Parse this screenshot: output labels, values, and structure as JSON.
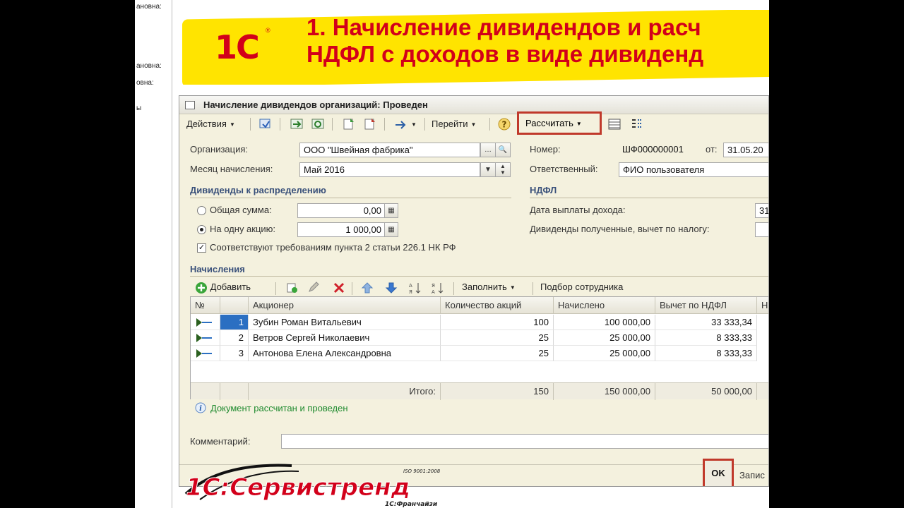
{
  "side_strip": [
    "ановна:",
    "ановна:",
    "овна:",
    "ы"
  ],
  "banner": {
    "logo": "1С",
    "line1": "1. Начисление дивидендов и расч",
    "line2": "НДФЛ с доходов в виде дивиденд"
  },
  "window": {
    "title": "Начисление дивидендов организаций: Проведен",
    "toolbar": {
      "actions_label": "Действия",
      "goto_label": "Перейти",
      "calculate_label": "Рассчитать"
    },
    "form": {
      "organization_label": "Организация:",
      "organization_value": "ООО \"Швейная фабрика\"",
      "month_label": "Месяц начисления:",
      "month_value": "Май 2016",
      "number_label": "Номер:",
      "number_value": "ШФ000000001",
      "date_label": "от:",
      "date_value": "31.05.20",
      "responsible_label": "Ответственный:",
      "responsible_value": "ФИО пользователя"
    },
    "dividends": {
      "section_title": "Дивиденды к распределению",
      "total_label": "Общая сумма:",
      "total_value": "0,00",
      "per_share_label": "На одну акцию:",
      "per_share_value": "1 000,00",
      "compliance_label": "Соответствуют требованиям пункта 2 статьи 226.1 НК РФ"
    },
    "ndfl": {
      "section_title": "НДФЛ",
      "payout_date_label": "Дата выплаты дохода:",
      "payout_date_value": "31",
      "received_label": "Дивиденды полученные, вычет по налогу:"
    },
    "accruals": {
      "section_title": "Начисления",
      "add_label": "Добавить",
      "fill_label": "Заполнить",
      "pick_label": "Подбор сотрудника",
      "columns": {
        "num": "№",
        "shareholder": "Акционер",
        "shares": "Количество акций",
        "accrued": "Начислено",
        "deduction": "Вычет по НДФЛ",
        "cut": "Н"
      },
      "rows": [
        {
          "num": "1",
          "name": "Зубин Роман Витальевич",
          "shares": "100",
          "accrued": "100 000,00",
          "deduction": "33 333,34"
        },
        {
          "num": "2",
          "name": "Ветров Сергей Николаевич",
          "shares": "25",
          "accrued": "25 000,00",
          "deduction": "8 333,33"
        },
        {
          "num": "3",
          "name": "Антонова Елена Александровна",
          "shares": "25",
          "accrued": "25 000,00",
          "deduction": "8 333,33"
        }
      ],
      "totals": {
        "label": "Итого:",
        "shares": "150",
        "accrued": "150 000,00",
        "deduction": "50 000,00"
      }
    },
    "status_message": "Документ рассчитан и проведен",
    "comment_label": "Комментарий:",
    "ok_label": "OK",
    "save_label": "Запис"
  },
  "bottom_logo": {
    "text": "1С:Сервистренд",
    "iso": "ISO 9001:2008",
    "franchise": "1С:Франчайзи"
  }
}
